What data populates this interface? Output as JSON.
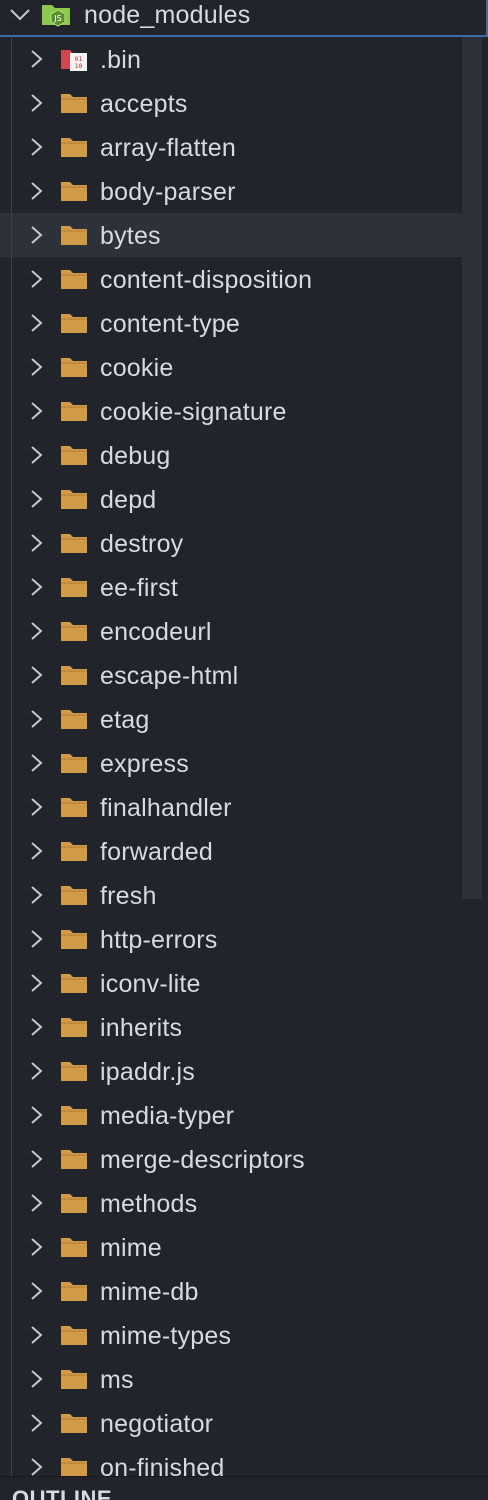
{
  "explorer": {
    "root": {
      "label": "node_modules",
      "icon": "nodejs-folder-icon",
      "expanded": true
    },
    "items": [
      {
        "label": ".bin",
        "icon": "binary-folder-icon"
      },
      {
        "label": "accepts",
        "icon": "folder-icon"
      },
      {
        "label": "array-flatten",
        "icon": "folder-icon"
      },
      {
        "label": "body-parser",
        "icon": "folder-icon"
      },
      {
        "label": "bytes",
        "icon": "folder-icon"
      },
      {
        "label": "content-disposition",
        "icon": "folder-icon"
      },
      {
        "label": "content-type",
        "icon": "folder-icon"
      },
      {
        "label": "cookie",
        "icon": "folder-icon"
      },
      {
        "label": "cookie-signature",
        "icon": "folder-icon"
      },
      {
        "label": "debug",
        "icon": "folder-icon"
      },
      {
        "label": "depd",
        "icon": "folder-icon"
      },
      {
        "label": "destroy",
        "icon": "folder-icon"
      },
      {
        "label": "ee-first",
        "icon": "folder-icon"
      },
      {
        "label": "encodeurl",
        "icon": "folder-icon"
      },
      {
        "label": "escape-html",
        "icon": "folder-icon"
      },
      {
        "label": "etag",
        "icon": "folder-icon"
      },
      {
        "label": "express",
        "icon": "folder-icon"
      },
      {
        "label": "finalhandler",
        "icon": "folder-icon"
      },
      {
        "label": "forwarded",
        "icon": "folder-icon"
      },
      {
        "label": "fresh",
        "icon": "folder-icon"
      },
      {
        "label": "http-errors",
        "icon": "folder-icon"
      },
      {
        "label": "iconv-lite",
        "icon": "folder-icon"
      },
      {
        "label": "inherits",
        "icon": "folder-icon"
      },
      {
        "label": "ipaddr.js",
        "icon": "folder-icon"
      },
      {
        "label": "media-typer",
        "icon": "folder-icon"
      },
      {
        "label": "merge-descriptors",
        "icon": "folder-icon"
      },
      {
        "label": "methods",
        "icon": "folder-icon"
      },
      {
        "label": "mime",
        "icon": "folder-icon"
      },
      {
        "label": "mime-db",
        "icon": "folder-icon"
      },
      {
        "label": "mime-types",
        "icon": "folder-icon"
      },
      {
        "label": "ms",
        "icon": "folder-icon"
      },
      {
        "label": "negotiator",
        "icon": "folder-icon"
      },
      {
        "label": "on-finished",
        "icon": "folder-icon"
      }
    ],
    "hovered_item": "bytes"
  },
  "outline": {
    "label": "OUTLINE"
  },
  "colors": {
    "background": "#21252b",
    "hover": "#2c313a",
    "folder": "#d19a46",
    "text": "#d7dae0",
    "focus_border": "#3a6ea5",
    "binary_icon": "#d0474f",
    "nodejs_icon": "#8cc84b"
  }
}
